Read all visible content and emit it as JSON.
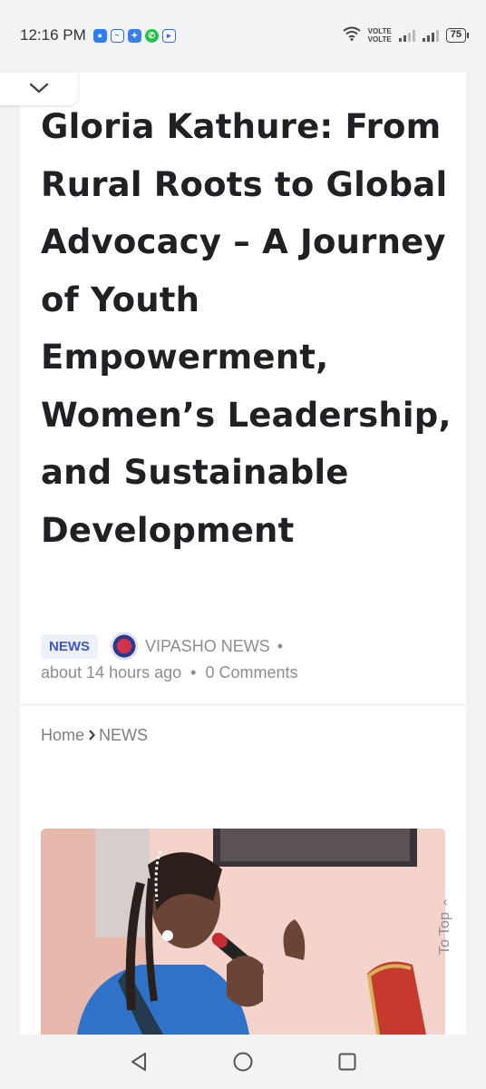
{
  "status_bar": {
    "time": "12:16 PM",
    "notification_icons": [
      "messages-icon",
      "messenger-icon",
      "app-icon",
      "whatsapp-icon",
      "youtube-icon"
    ],
    "network_label_1": "VOLTE",
    "network_label_2": "VOLTE",
    "battery_level": "75"
  },
  "article": {
    "title": "Gloria Kathure: From Rural Roots to Global Advocacy – A Journey of Youth Empowerment, Women’s Leadership, and Sustainable Development",
    "category": "NEWS",
    "author": "VIPASHO NEWS",
    "separator": "•",
    "time_ago": "about 14 hours ago",
    "comments": "0 Comments"
  },
  "breadcrumb": {
    "home": "Home",
    "current": "NEWS"
  },
  "to_top_label": "To Top",
  "colors": {
    "accent": "#3e56c7",
    "badge_bg": "#eef1fb",
    "meta_text": "#8a8d93",
    "title_text": "#1f2125"
  }
}
